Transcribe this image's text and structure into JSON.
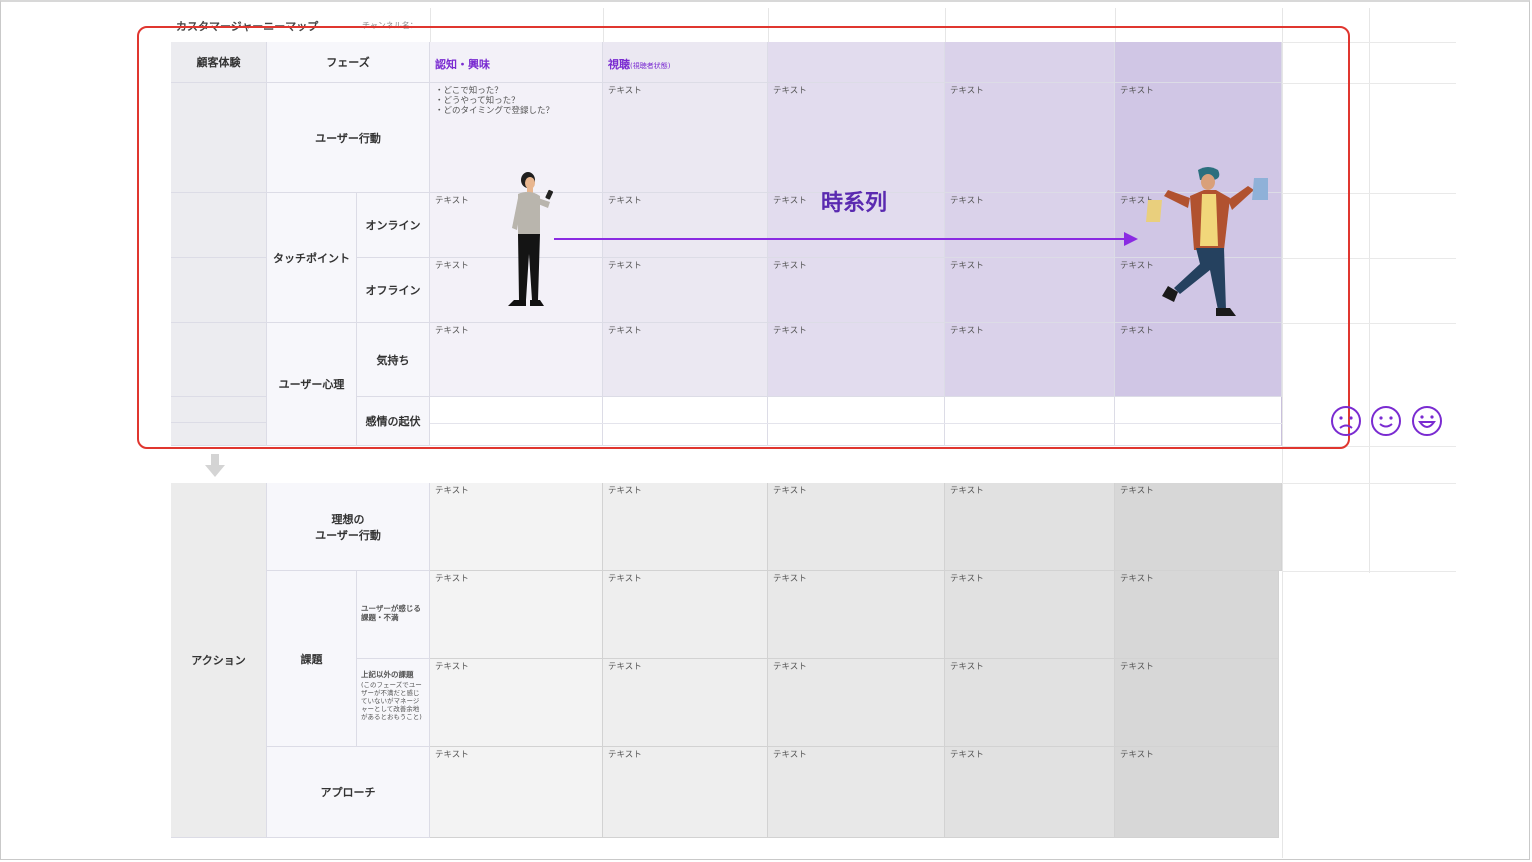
{
  "page": {
    "title": "カスタマージャーニーマップ",
    "channel": "チャンネル名："
  },
  "header": {
    "col1": "顧客体験",
    "col2": "フェーズ"
  },
  "phases": [
    {
      "label": "認知・興味",
      "sub": ""
    },
    {
      "label": "視聴",
      "sub": "(視聴者状態)"
    },
    {
      "label": "",
      "sub": ""
    },
    {
      "label": "",
      "sub": ""
    },
    {
      "label": "",
      "sub": ""
    }
  ],
  "rows": {
    "user_action": "ユーザー行動",
    "touchpoint": "タッチポイント",
    "online": "オンライン",
    "offline": "オフライン",
    "mind": "ユーザー心理",
    "feeling": "気持ち",
    "emotion": "感情の起伏",
    "action": "アクション",
    "ideal": "理想の\nユーザー行動",
    "issue": "課題",
    "issue_user": "ユーザーが感じる課題・不満",
    "issue_other_title": "上記以外の課題",
    "issue_other_note": "(このフェーズでユーザーが不満だと感じていないがマネージャーとして改善余地があるとおもうこと)",
    "approach": "アプローチ"
  },
  "cells": {
    "first_user_action": "・どこで知った？\n・どうやって知った？\n・どのタイミングで登録した？",
    "placeholder": "テキスト"
  },
  "annotation": {
    "timeline": "時系列"
  },
  "icons": [
    "sad-face-icon",
    "smile-face-icon",
    "grin-face-icon",
    "down-arrow-icon"
  ],
  "colors": {
    "accent": "#7a2bd1",
    "highlight_border": "#e0362f",
    "phase_bg": [
      "#f3f1f8",
      "#ebe8f2",
      "#e2dcee",
      "#dad2ea",
      "#d0c6e5"
    ],
    "action_bg": [
      "#f3f3f3",
      "#eeeeee",
      "#e8e8e8",
      "#e1e1e1",
      "#d7d7d7"
    ]
  }
}
